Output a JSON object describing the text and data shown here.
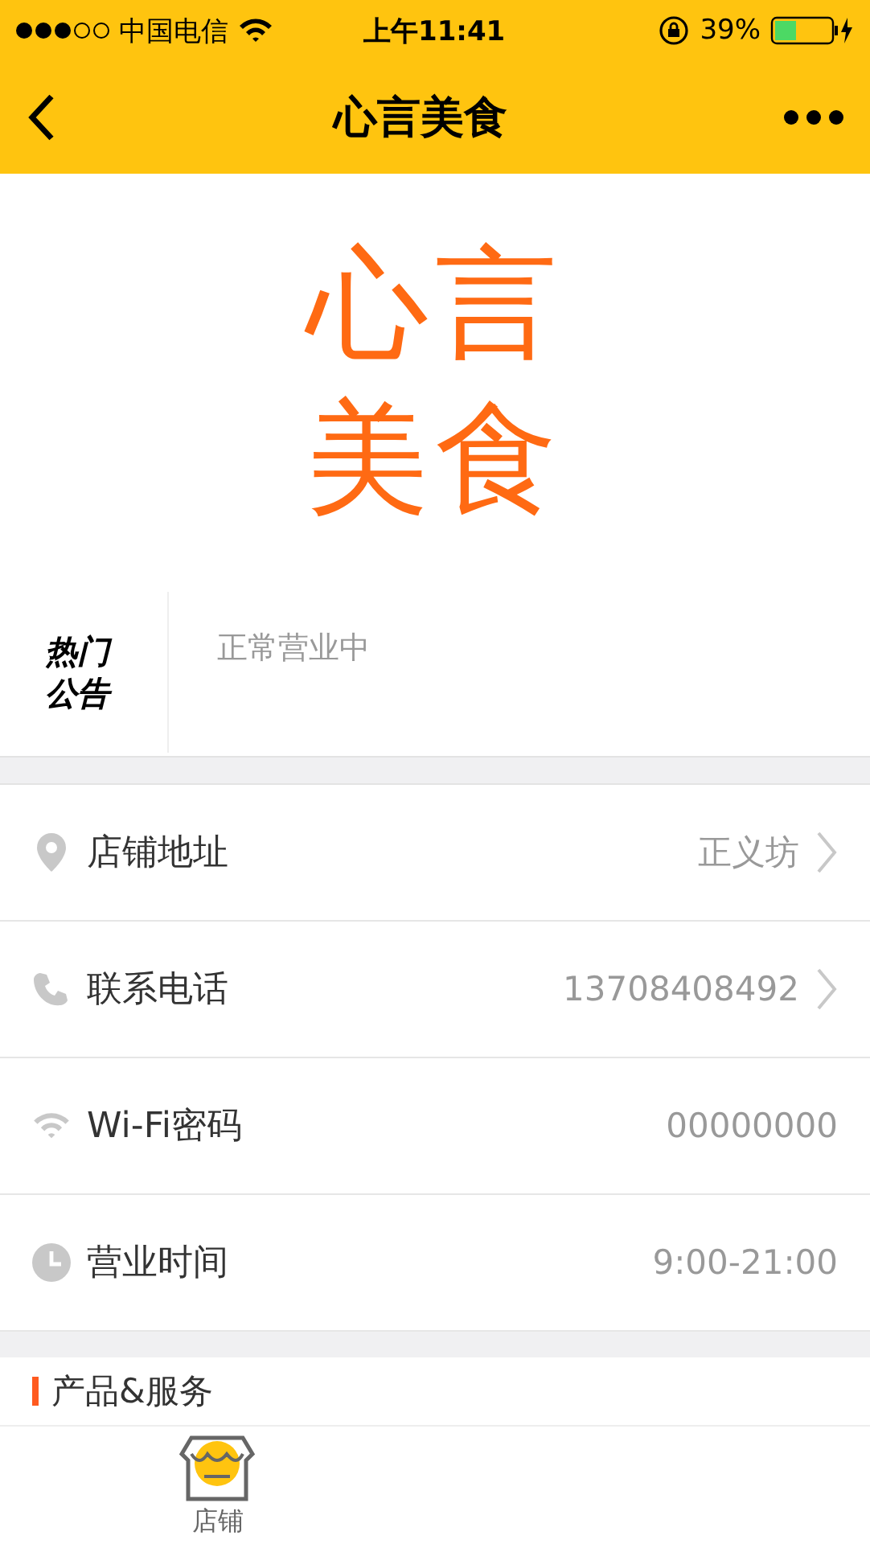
{
  "status_bar": {
    "carrier": "中国电信",
    "time": "上午11:41",
    "battery": "39%"
  },
  "nav": {
    "title": "心言美食"
  },
  "logo": {
    "lines": [
      "心言",
      "美食"
    ]
  },
  "notice": {
    "label": "热门公告",
    "text": "正常营业中"
  },
  "info_rows": [
    {
      "kind": "location",
      "label": "店铺地址",
      "value": "正义坊",
      "link": true
    },
    {
      "kind": "phone",
      "label": "联系电话",
      "value": "13708408492",
      "link": true
    },
    {
      "kind": "wifi",
      "label": "Wi-Fi密码",
      "value": "00000000",
      "link": false
    },
    {
      "kind": "clock",
      "label": "营业时间",
      "value": "9:00-21:00",
      "link": false
    }
  ],
  "section": {
    "title": "产品&服务"
  },
  "tab_bar": [
    {
      "label": "店铺",
      "selected": true
    }
  ]
}
